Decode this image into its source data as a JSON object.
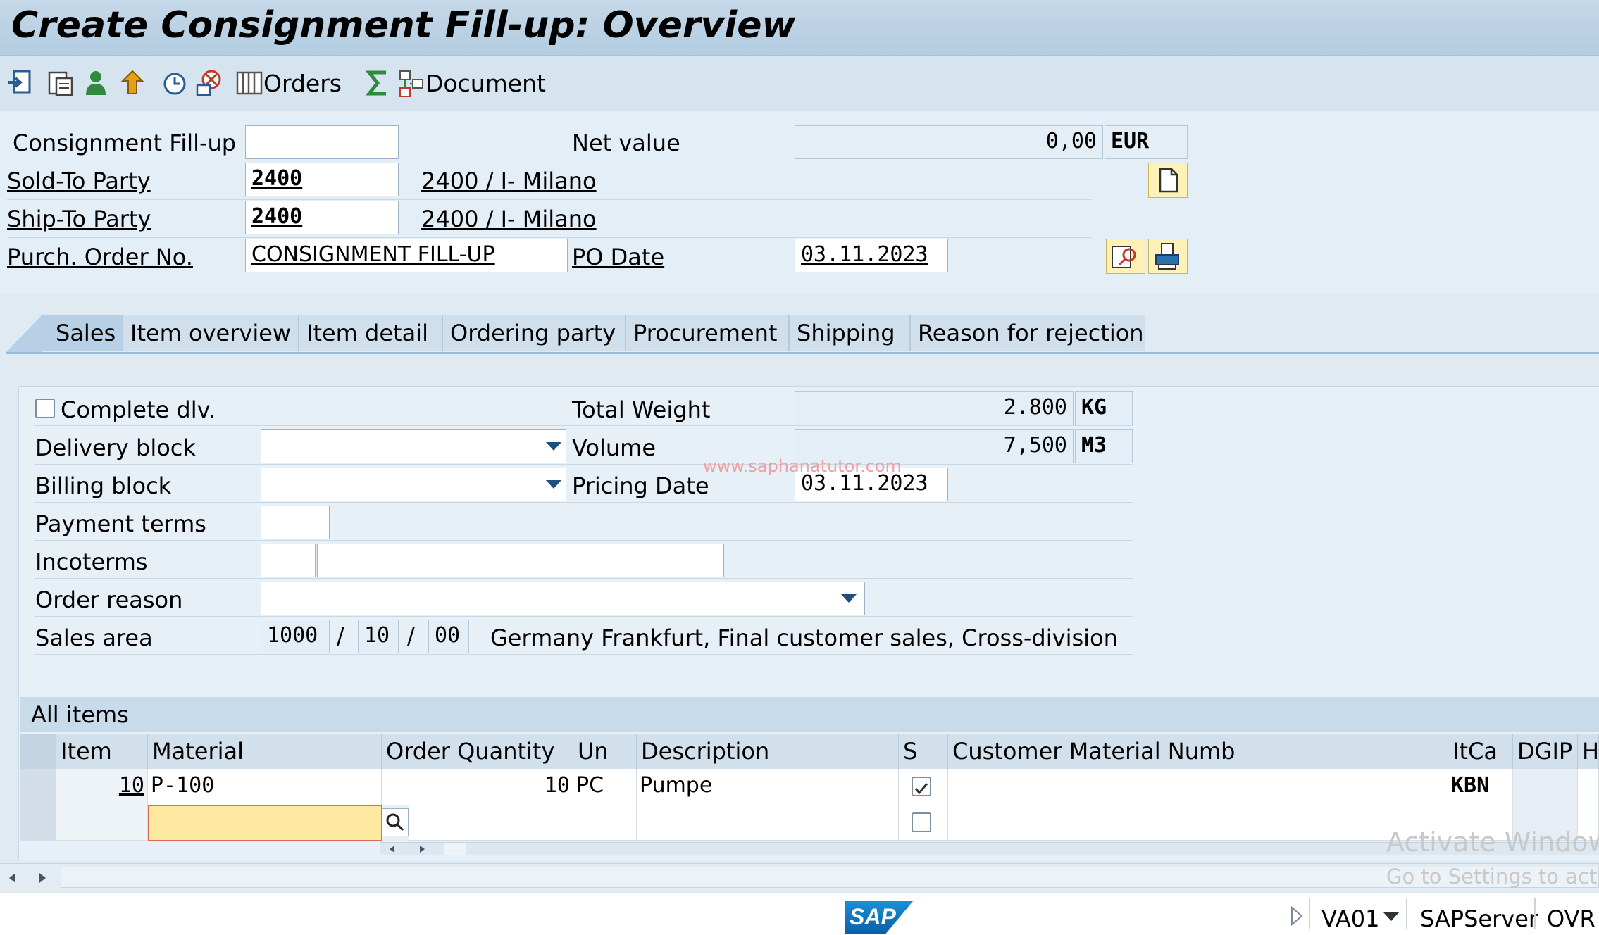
{
  "window": {
    "title": "Create Consignment Fill-up: Overview"
  },
  "toolbar": {
    "icons": [
      "display-doc-icon",
      "header-details-icon",
      "partner-icon",
      "upward-icon",
      "item-details-icon",
      "delete-item-icon",
      "orders-list-icon",
      "sum-icon",
      "document-flow-icon"
    ],
    "orders_label": "Orders",
    "document_label": "Document"
  },
  "header": {
    "consignment_label": "Consignment Fill-up",
    "consignment_value": "",
    "net_value_label": "Net value",
    "net_value": "0,00",
    "currency": "EUR",
    "sold_to_label": "Sold-To Party",
    "sold_to_value": "2400",
    "sold_to_desc": "2400 / I- Milano",
    "ship_to_label": "Ship-To Party",
    "ship_to_value": "2400",
    "ship_to_desc": "2400 / I- Milano",
    "po_label": "Purch. Order No.",
    "po_value": "CONSIGNMENT FILL-UP",
    "po_date_label": "PO Date",
    "po_date_value": "03.11.2023"
  },
  "tabs": [
    {
      "label": "Sales",
      "active": true
    },
    {
      "label": "Item overview"
    },
    {
      "label": "Item detail"
    },
    {
      "label": "Ordering party"
    },
    {
      "label": "Procurement"
    },
    {
      "label": "Shipping"
    },
    {
      "label": "Reason for rejection"
    }
  ],
  "sales": {
    "complete_dlv_label": "Complete dlv.",
    "complete_dlv_checked": false,
    "delivery_block_label": "Delivery block",
    "delivery_block_value": "",
    "billing_block_label": "Billing block",
    "billing_block_value": "",
    "payment_terms_label": "Payment terms",
    "payment_terms_value": "",
    "incoterms_label": "Incoterms",
    "incoterms_value1": "",
    "incoterms_value2": "",
    "order_reason_label": "Order reason",
    "order_reason_value": "",
    "sales_area_label": "Sales area",
    "sales_org": "1000",
    "dist_channel": "10",
    "division": "00",
    "sales_area_sep": "/",
    "sales_area_desc": "Germany Frankfurt, Final customer sales, Cross-division",
    "total_weight_label": "Total Weight",
    "total_weight_value": "2.800",
    "weight_unit": "KG",
    "volume_label": "Volume",
    "volume_value": "7,500",
    "volume_unit": "M3",
    "pricing_date_label": "Pricing Date",
    "pricing_date_value": "03.11.2023"
  },
  "items": {
    "title": "All items",
    "columns": [
      "Item",
      "Material",
      "Order Quantity",
      "Un",
      "Description",
      "S",
      "Customer Material Numb",
      "ItCa",
      "DGIP",
      "HL"
    ],
    "rows": [
      {
        "item": "10",
        "material": "P-100",
        "qty": "10",
        "un": "PC",
        "desc": "Pumpe",
        "s": true,
        "cust_mat": "",
        "itca": "KBN",
        "dgip": "",
        "hl": ""
      },
      {
        "item": "",
        "material": "",
        "qty": "",
        "un": "",
        "desc": "",
        "s": false,
        "cust_mat": "",
        "itca": "",
        "dgip": "",
        "hl": ""
      }
    ]
  },
  "watermarks": {
    "site": "www.saphanatutor.com",
    "activate_title": "Activate Window",
    "activate_sub": "Go to Settings to activa"
  },
  "status_bar": {
    "logo": "SAP",
    "transaction": "VA01",
    "server": "SAPServer",
    "mode": "OVR"
  },
  "colors": {
    "title_bar": "#b4cde1",
    "highlight_cell": "#fde9a0",
    "link": "#000000",
    "dropdown_arrow": "#1f4e82"
  }
}
